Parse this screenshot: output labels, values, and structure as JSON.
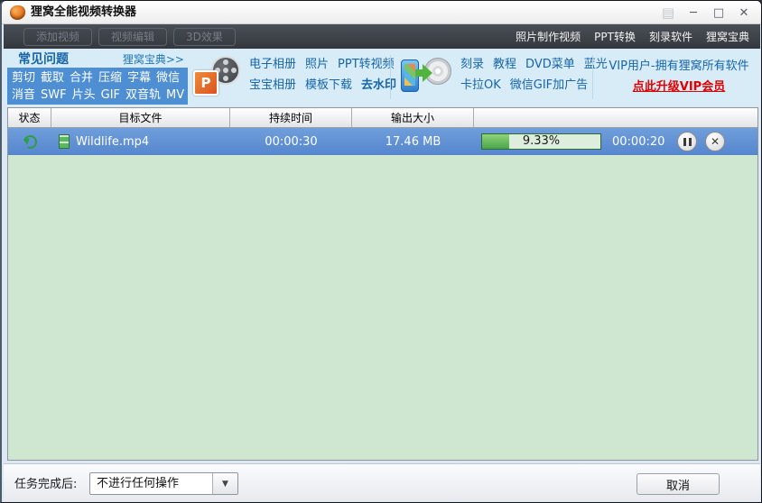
{
  "window": {
    "title": "狸窝全能视频转换器"
  },
  "icons": {
    "menu_glyph": "▤",
    "minimize_glyph": "─",
    "maximize_glyph": "□",
    "close_glyph": "✕",
    "dropdown_glyph": "▼",
    "ppt_letter": "P"
  },
  "toolbar": {
    "buttons": [
      "添加视频",
      "视频编辑",
      "3D效果"
    ],
    "links": [
      "照片制作视频",
      "PPT转换",
      "刻录软件",
      "狸窝宝典"
    ]
  },
  "promo": {
    "faq": {
      "title": "常见问题",
      "more": "狸窝宝典>>",
      "row1": [
        "剪切",
        "截取",
        "合并",
        "压缩",
        "字幕",
        "微信"
      ],
      "row2": [
        "消音",
        "SWF",
        "片头",
        "GIF",
        "双音轨",
        "MV"
      ]
    },
    "ppt": {
      "row1": [
        "电子相册",
        "照片",
        "PPT转视频"
      ],
      "row2": [
        "宝宝相册",
        "模板下载",
        "去水印"
      ]
    },
    "burn": {
      "row1": [
        "刻录",
        "教程",
        "DVD菜单",
        "蓝光"
      ],
      "row2": [
        "卡拉OK",
        "微信GIF加广告"
      ]
    },
    "vip": {
      "line1": "VIP用户-拥有狸窝所有软件",
      "line2": "点此升级VIP会员"
    }
  },
  "table": {
    "headers": [
      "状态",
      "目标文件",
      "持续时间",
      "输出大小",
      ""
    ],
    "row": {
      "file": "Wildlife.mp4",
      "duration": "00:00:30",
      "size": "17.46 MB",
      "progress_label": "9.33%",
      "progress_percent": 9.33,
      "progress_fill_percent": 23,
      "elapsed": "00:00:20"
    }
  },
  "footer": {
    "after_task_label": "任务完成后:",
    "after_task_value": "不进行任何操作",
    "cancel_label": "取消"
  },
  "colors": {
    "toolbar_dark": "#3b4047",
    "promo_bg": "#d8ecf7",
    "promo_panel_blue": "#4e8ed2",
    "link_blue": "#1565a8",
    "vip_red": "#e00000",
    "row_selected_blue": "#5b8ed2",
    "list_bg_green": "#cfe6d0",
    "progress_green": "#4aa44c",
    "progress_track": "#ddeedd"
  }
}
